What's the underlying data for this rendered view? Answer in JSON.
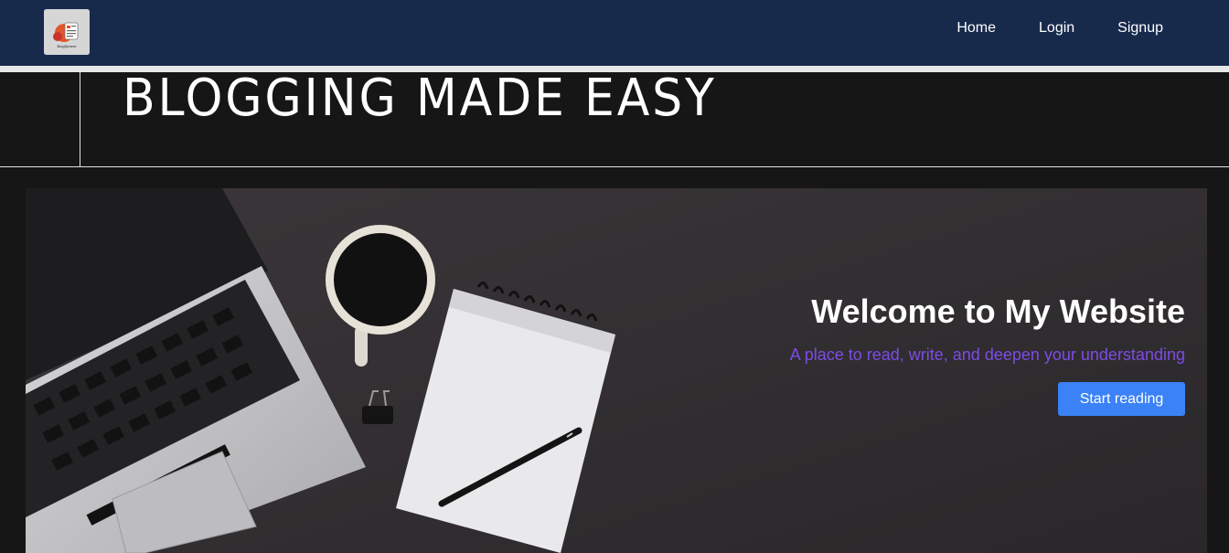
{
  "nav": {
    "logo_text": "BlogSphere",
    "links": [
      {
        "label": "Home"
      },
      {
        "label": "Login"
      },
      {
        "label": "Signup"
      }
    ]
  },
  "banner": {
    "title": "BLOGGING MADE EASY"
  },
  "hero": {
    "heading": "Welcome to My Website",
    "subtitle": "A place to read, write, and deepen your understanding",
    "cta_label": "Start reading",
    "photo_subject": "laptop-coffee-notebook-pen"
  },
  "colors": {
    "nav_bg": "#172a4c",
    "subtitle": "#7d4be6",
    "button": "#3b82f6"
  }
}
